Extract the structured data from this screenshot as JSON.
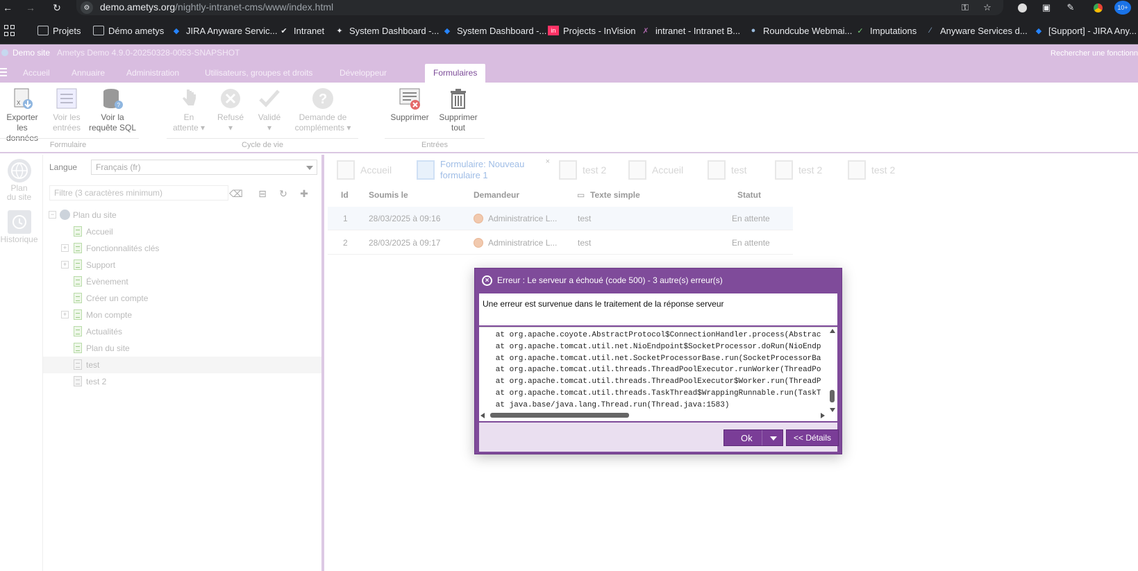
{
  "browser": {
    "url_host": "demo.ametys.org",
    "url_path": "/nightly-intranet-cms/www/index.html",
    "bookmarks": [
      "Projets",
      "Démo ametys",
      "JIRA Anyware Servic...",
      "Intranet",
      "System Dashboard -...",
      "System Dashboard -...",
      "Projects - InVision",
      "intranet - Intranet B...",
      "Roundcube Webmai...",
      "Imputations",
      "Anyware Services d...",
      "[Support] - JIRA Any..."
    ],
    "ext_badge": "10+"
  },
  "app": {
    "site_name": "Demo site",
    "version": "Ametys Demo 4.9.0-20250328-0053-SNAPSHOT",
    "search_placeholder": "Rechercher une fonctionn"
  },
  "ribbon_tabs": [
    "Accueil",
    "Annuaire",
    "Administration",
    "Utilisateurs, groupes et droits",
    "Développeur",
    "Formulaires"
  ],
  "ribbon": {
    "buttons": {
      "export": [
        "Exporter les",
        "données"
      ],
      "view_entries": [
        "Voir les",
        "entrées"
      ],
      "view_sql": [
        "Voir la",
        "requête SQL"
      ],
      "pending": [
        "En",
        "attente"
      ],
      "refused": "Refusé",
      "validated": "Validé",
      "request_more": [
        "Demande de",
        "compléments"
      ],
      "delete": "Supprimer",
      "delete_all": [
        "Supprimer",
        "tout"
      ]
    },
    "groups": {
      "form": "Formulaire",
      "lifecycle": "Cycle de vie",
      "entries": "Entrées"
    }
  },
  "left_tools": {
    "sitemap": [
      "Plan",
      "du site"
    ],
    "history": "Historique"
  },
  "tree": {
    "lang_label": "Langue",
    "lang_value": "Français (fr)",
    "filter_placeholder": "Filtre (3 caractères minimum)",
    "root": "Plan du site",
    "nodes": [
      "Accueil",
      "Fonctionnalités clés",
      "Support",
      "Évènement",
      "Créer un compte",
      "Mon compte",
      "Actualités",
      "Plan du site",
      "test",
      "test 2"
    ]
  },
  "main_tabs": [
    "Accueil",
    "Formulaire: Nouveau",
    "formulaire 1",
    "test 2",
    "Accueil",
    "test",
    "test 2",
    "test 2"
  ],
  "grid": {
    "columns": [
      "Id",
      "Soumis le",
      "Demandeur",
      "Texte simple",
      "Statut"
    ],
    "rows": [
      {
        "id": "1",
        "date": "28/03/2025 à 09:16",
        "user": "Administratrice L...",
        "text": "test",
        "status": "En attente"
      },
      {
        "id": "2",
        "date": "28/03/2025 à 09:17",
        "user": "Administratrice L...",
        "text": "test",
        "status": "En attente"
      }
    ]
  },
  "dialog": {
    "title": "Erreur : Le serveur a échoué (code 500) - 3 autre(s) erreur(s)",
    "message": "Une erreur est survenue dans le traitement de la réponse serveur",
    "trace": "   at org.apache.coyote.AbstractProtocol$ConnectionHandler.process(AbstractProtocol.java)\n   at org.apache.tomcat.util.net.NioEndpoint$SocketProcessor.doRun(NioEndpoint.java)\n   at org.apache.tomcat.util.net.SocketProcessorBase.run(SocketProcessorBase.java)\n   at org.apache.tomcat.util.threads.ThreadPoolExecutor.runWorker(ThreadPoolExecutor.java)\n   at org.apache.tomcat.util.threads.ThreadPoolExecutor$Worker.run(ThreadPoolExecutor.java)\n   at org.apache.tomcat.util.threads.TaskThread$WrappingRunnable.run(TaskThread.java)\n   at java.base/java.lang.Thread.run(Thread.java:1583)",
    "ok_label": "Ok",
    "details_label": "<< Détails"
  }
}
